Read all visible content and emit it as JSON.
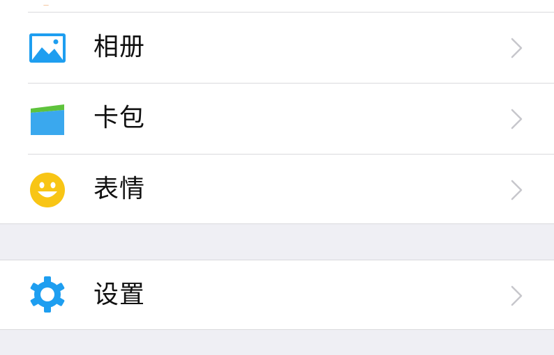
{
  "menu": {
    "items": [
      {
        "label": "相册",
        "icon": "photo-album-icon",
        "icon_color": "#1e9ef0"
      },
      {
        "label": "卡包",
        "icon": "card-wallet-icon",
        "icon_color": "#3aa8ee"
      },
      {
        "label": "表情",
        "icon": "smiley-face-icon",
        "icon_color": "#f8c515"
      }
    ],
    "settings": {
      "label": "设置",
      "icon": "gear-icon",
      "icon_color": "#1e9ef0"
    }
  },
  "colors": {
    "background": "#efeff4",
    "cell": "#ffffff",
    "separator": "#d9d9dc",
    "chevron": "#c7c7cc",
    "text": "#111111"
  }
}
